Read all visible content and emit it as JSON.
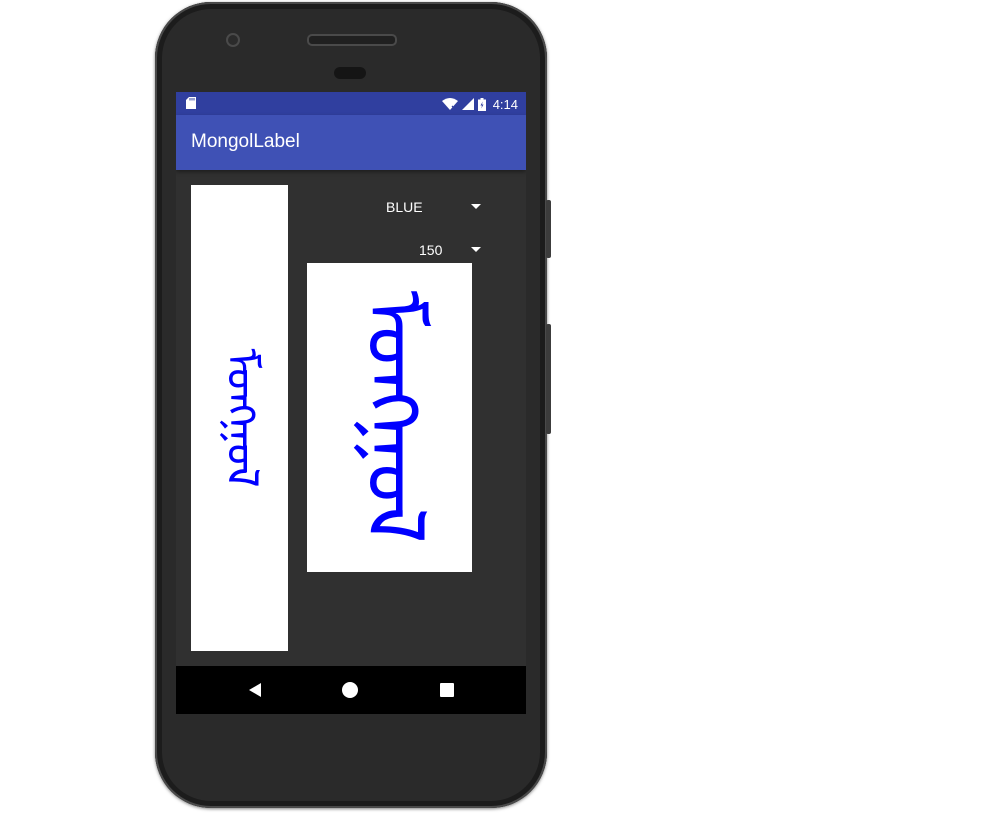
{
  "status_bar": {
    "time": "4:14"
  },
  "app_bar": {
    "title": "MongolLabel"
  },
  "color_spinner": {
    "value": "BLUE"
  },
  "size_spinner": {
    "value": "150"
  },
  "mongol_label": {
    "text": "ᠮᠣᠩᠭᠣᠯ",
    "color": "#0000ff"
  },
  "colors": {
    "status_bar": "#303f9f",
    "app_bar": "#3f51b5",
    "background": "#303030",
    "label_background": "#ffffff",
    "nav_bar": "#000000"
  },
  "icons": [
    "sd-card-icon",
    "wifi-icon",
    "signal-icon",
    "battery-icon",
    "back-icon",
    "home-icon",
    "recents-icon"
  ]
}
